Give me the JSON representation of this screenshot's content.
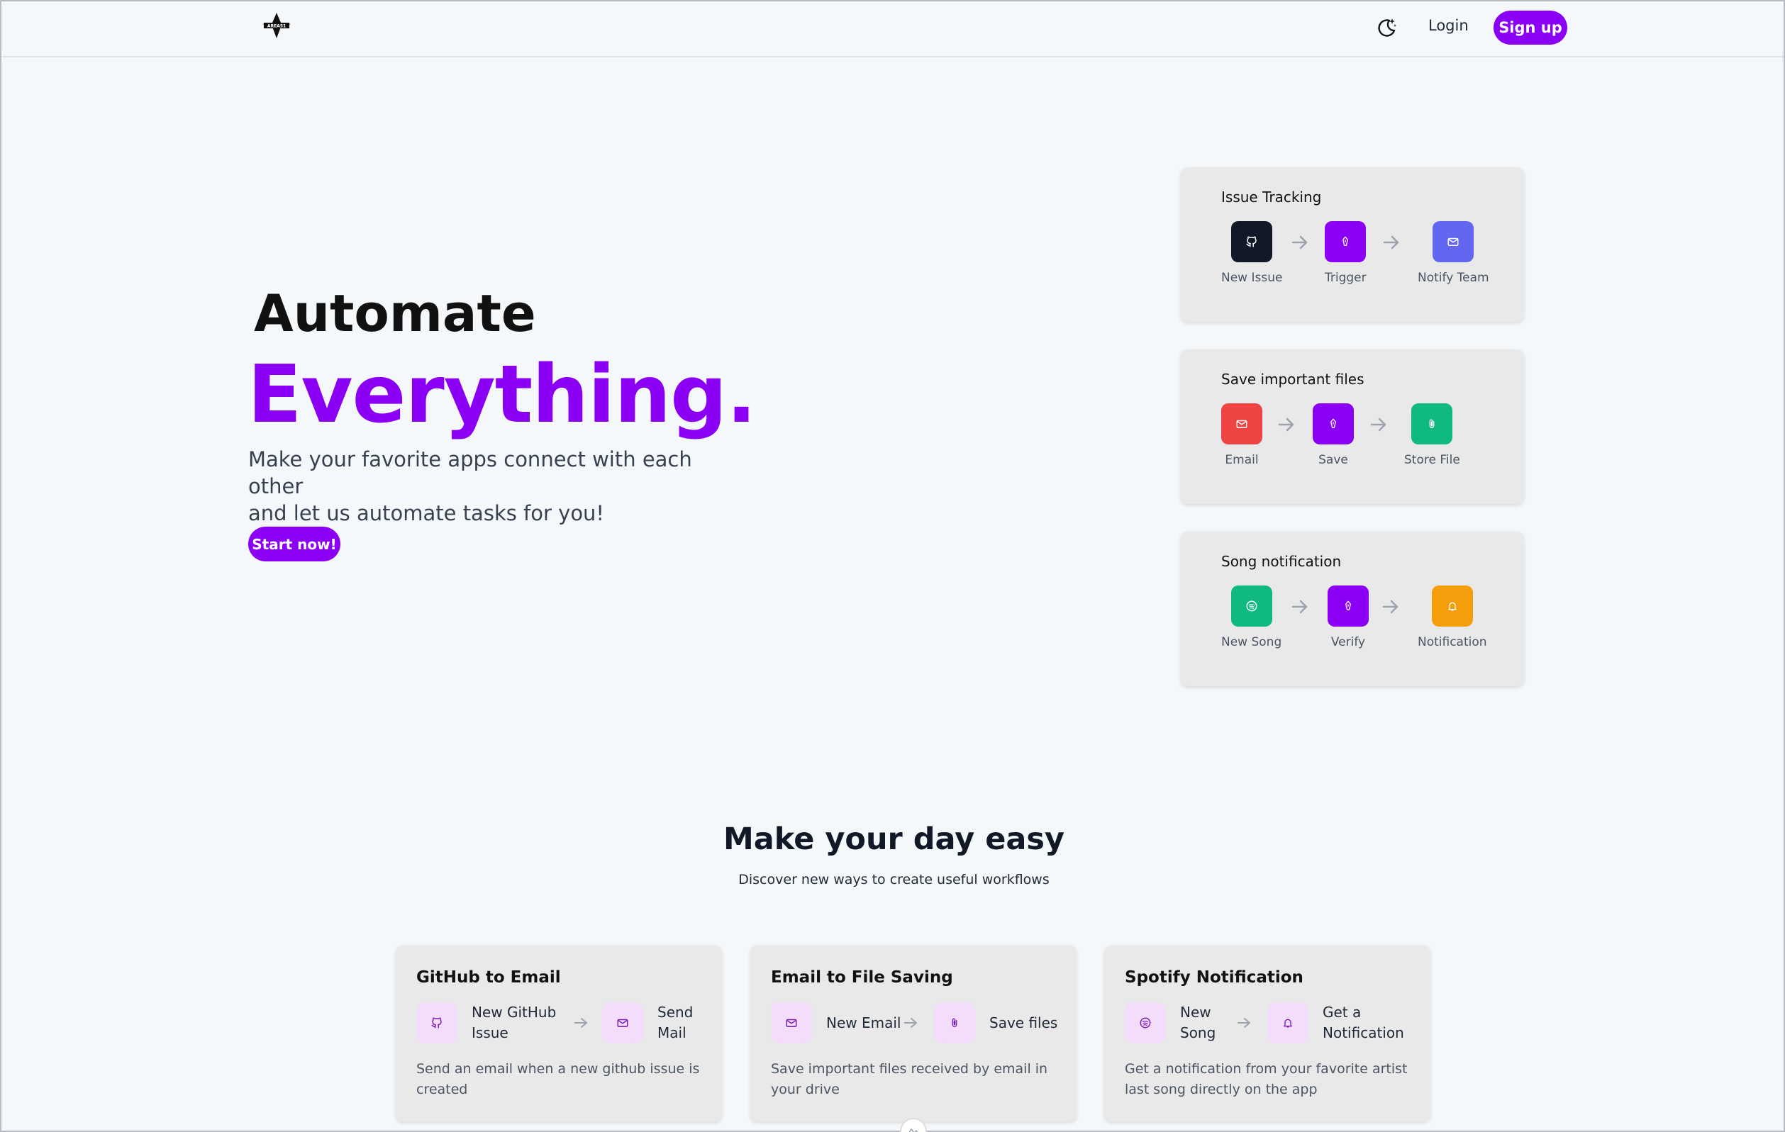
{
  "navbar": {
    "logo_text": "AREA51",
    "theme_icon": "moon-stars-icon",
    "login_label": "Login",
    "signup_label": "Sign up"
  },
  "hero": {
    "title_line1": "Automate",
    "title_line2": "Everything.",
    "subtitle_line1": "Make your favorite apps connect with each other",
    "subtitle_line2": "and let us automate tasks for you!",
    "cta_label": "Start now!"
  },
  "flows": [
    {
      "title": "Issue Tracking",
      "steps": [
        {
          "label": "New Issue",
          "icon": "github-icon",
          "color": "#111827"
        },
        {
          "label": "Trigger",
          "icon": "pen-icon",
          "color": "#8b00f5"
        },
        {
          "label": "Notify Team",
          "icon": "mail-icon",
          "color": "#6366f1"
        }
      ]
    },
    {
      "title": "Save important files",
      "steps": [
        {
          "label": "Email",
          "icon": "mail-icon",
          "color": "#ef4444"
        },
        {
          "label": "Save",
          "icon": "pen-icon",
          "color": "#8b00f5"
        },
        {
          "label": "Store File",
          "icon": "paperclip-icon",
          "color": "#10b981"
        }
      ]
    },
    {
      "title": "Song notification",
      "steps": [
        {
          "label": "New Song",
          "icon": "spotify-icon",
          "color": "#10b981"
        },
        {
          "label": "Verify",
          "icon": "pen-icon",
          "color": "#8b00f5"
        },
        {
          "label": "Notification",
          "icon": "bell-icon",
          "color": "#f59e0b"
        }
      ]
    }
  ],
  "section": {
    "title": "Make your day easy",
    "subtitle": "Discover new ways to create useful workflows"
  },
  "workflows": [
    {
      "title": "GitHub to Email",
      "step1_line1": "New GitHub",
      "step1_line2": "Issue",
      "step2_line1": "Send",
      "step2_line2": "Mail",
      "description": "Send an email when a new github issue is created"
    },
    {
      "title": "Email to File Saving",
      "step1_line1": "New Email",
      "step1_line2": "",
      "step2_line1": "Save files",
      "step2_line2": "",
      "description": "Save important files received by email in your drive"
    },
    {
      "title": "Spotify Notification",
      "step1_line1": "New",
      "step1_line2": "Song",
      "step2_line1": "Get a",
      "step2_line2": "Notification",
      "description": "Get a notification from your favorite artist last song directly on the app"
    }
  ],
  "colors": {
    "accent": "#8b00f5",
    "background": "#f5f8fa",
    "card": "#e9e9ea",
    "icon_tint": "#f4dcfb"
  }
}
